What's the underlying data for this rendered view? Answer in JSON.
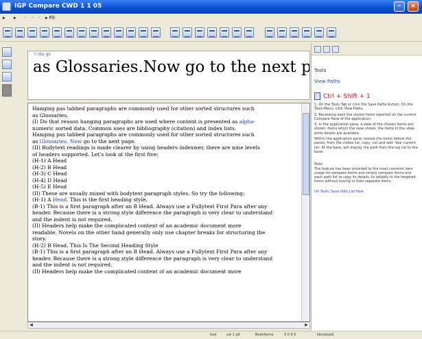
{
  "window": {
    "title": "IGP Compare   CWD 1 1 05"
  },
  "window_controls": {
    "minimize": "–",
    "close": "×"
  },
  "menu": [
    "▸",
    "▸",
    "·",
    "·",
    "·",
    "▸ Fil·"
  ],
  "banner": {
    "label": "t·nks gs",
    "text": "as Glossaries.Now go to the next page."
  },
  "document": {
    "paragraphs": [
      {
        "segments": [
          {
            "text": "Hanging pas tabbed paragraphs are commonly used for other sorted structures such"
          }
        ]
      },
      {
        "segments": [
          {
            "text": "as Glossaries."
          }
        ]
      },
      {
        "segments": [
          {
            "text": "(I) Do that reason hanging paragraphs are used where content is presented as "
          },
          {
            "text": "alpha-",
            "link": true
          }
        ]
      },
      {
        "segments": [
          {
            "text": "numeric sorted data. Common uses are bibliography (citation) and index lists."
          }
        ]
      },
      {
        "segments": [
          {
            "text": "Hanging pas tabbed paragraphs are commonly used for other sorted structures such"
          }
        ]
      },
      {
        "segments": [
          {
            "text": "as "
          },
          {
            "text": "Glossaries. Now",
            "link": true
          },
          {
            "text": " go to the next page."
          }
        ]
      },
      {
        "segments": [
          {
            "text": "(II) Bodytext readings is made clearer by using headers indexwer, there are nine levels"
          }
        ]
      },
      {
        "segments": [
          {
            "text": "of headers supported. Let's look at the first five:"
          }
        ]
      },
      {
        "segments": [
          {
            "text": "(H-1) A Head"
          }
        ]
      },
      {
        "segments": [
          {
            "text": "(H-2) B Head"
          }
        ]
      },
      {
        "segments": [
          {
            "text": "(H-3) C Head"
          }
        ]
      },
      {
        "segments": [
          {
            "text": "(H-4) D Head"
          }
        ]
      },
      {
        "segments": [
          {
            "text": "(H-5) E Head"
          }
        ]
      },
      {
        "segments": [
          {
            "text": "(II) These are usually mixed with bodytext paragraph styles. So try the following:"
          }
        ]
      },
      {
        "segments": [
          {
            "text": "(H-1) A "
          },
          {
            "text": "Head",
            "link": true
          },
          {
            "text": ". This is the first heading style."
          }
        ]
      },
      {
        "segments": [
          {
            "text": "(B-1) This is a first paragraph after an B Head. Always use a Fullytext First Para after any"
          }
        ]
      },
      {
        "segments": [
          {
            "text": "header. Because there is a strong style difference the paragraph is very clear to understand"
          }
        ]
      },
      {
        "segments": [
          {
            "text": "and the indent is not required."
          }
        ]
      },
      {
        "segments": [
          {
            "text": "(II) Headers help make the complicated content of an academic document more"
          }
        ]
      },
      {
        "segments": [
          {
            "text": "readable. Novels on the other hand generally only use chapter breaks for structuring the"
          }
        ]
      },
      {
        "segments": [
          {
            "text": "story."
          }
        ]
      },
      {
        "segments": [
          {
            "text": "(H-2) B Head. This Is The Second Heading Style"
          }
        ]
      },
      {
        "segments": [
          {
            "text": "(B-1) This is a first paragraph after an B Head. Always use a Fullytext First Para after any"
          }
        ]
      },
      {
        "segments": [
          {
            "text": "header. Because there is a strong style difference the paragraph is very clear to understand"
          }
        ]
      },
      {
        "segments": [
          {
            "text": "and the indent is not required."
          }
        ]
      },
      {
        "segments": [
          {
            "text": "(II) Headers help make the complicated content of an academic document more"
          }
        ]
      }
    ]
  },
  "pane": {
    "header": "Tools",
    "link": "View Paths",
    "tile_title": "Ctrl + Shift + 1",
    "steps": [
      "1. On the Tools Tab or click the Save Paths button. On the Tools Menu, click View Paths.",
      "2. Reviewing each the stored items reported on the current Compare Pane of the application.",
      "3. In the application pane, a view of the chosen items are shown. Items which the view shows, the items in the view, write details are available.",
      "Within the application pane, review the items before the panes, from the visible list, copy, cut and add. Your current list. At the base, will display the path from the top list to the base."
    ],
    "note_label": "Note",
    "note": "The feature has been provided to the most common item usage for compare items and simply compare items and each path list to copy its details, to reliably to the targeted items without having to then separate items.",
    "footer": "On Tools, Save Path List Now"
  },
  "status": {
    "fields": [
      "tool",
      "cal 1 pit",
      "Bookitems",
      "0 0 0 0",
      "kbrowsed"
    ]
  }
}
